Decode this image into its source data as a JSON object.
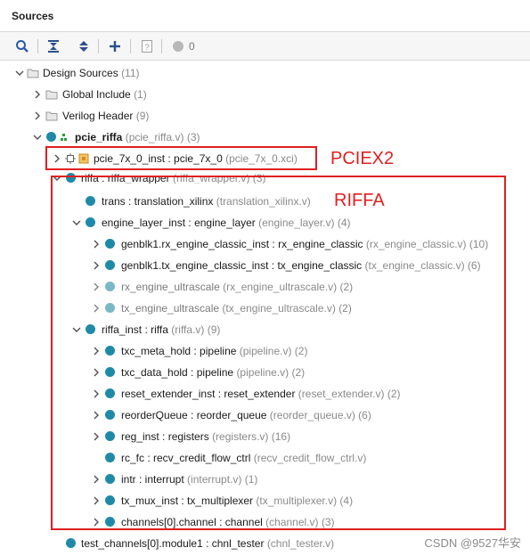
{
  "panel": {
    "title": "Sources"
  },
  "toolbar": {
    "warning_count": "0"
  },
  "tree": {
    "design_sources": {
      "label": "Design Sources",
      "count": "(11)"
    },
    "global_include": {
      "label": "Global Include",
      "count": "(1)"
    },
    "verilog_header": {
      "label": "Verilog Header",
      "count": "(9)"
    },
    "top": {
      "label": "pcie_riffa",
      "file": "(pcie_riffa.v) (3)"
    },
    "pcie_ip": {
      "label": "pcie_7x_0_inst : pcie_7x_0",
      "file": "(pcie_7x_0.xci)"
    },
    "riffa_wrapper": {
      "label": "riffa : riffa_wrapper",
      "file": "(riffa_wrapper.v) (3)"
    },
    "trans": {
      "label": "trans : translation_xilinx",
      "file": "(translation_xilinx.v)"
    },
    "engine_layer": {
      "label": "engine_layer_inst : engine_layer",
      "file": "(engine_layer.v) (4)"
    },
    "rx_classic": {
      "label": "genblk1.rx_engine_classic_inst : rx_engine_classic",
      "file": "(rx_engine_classic.v) (10)"
    },
    "tx_classic": {
      "label": "genblk1.tx_engine_classic_inst : tx_engine_classic",
      "file": "(tx_engine_classic.v) (6)"
    },
    "rx_ultra": {
      "label": "rx_engine_ultrascale",
      "file": "(rx_engine_ultrascale.v) (2)"
    },
    "tx_ultra": {
      "label": "tx_engine_ultrascale",
      "file": "(tx_engine_ultrascale.v) (2)"
    },
    "riffa_inst": {
      "label": "riffa_inst : riffa",
      "file": "(riffa.v) (9)"
    },
    "txc_meta": {
      "label": "txc_meta_hold : pipeline",
      "file": "(pipeline.v) (2)"
    },
    "txc_data": {
      "label": "txc_data_hold : pipeline",
      "file": "(pipeline.v) (2)"
    },
    "reset_ext": {
      "label": "reset_extender_inst : reset_extender",
      "file": "(reset_extender.v) (2)"
    },
    "reorder": {
      "label": "reorderQueue : reorder_queue",
      "file": "(reorder_queue.v) (6)"
    },
    "reg_inst": {
      "label": "reg_inst : registers",
      "file": "(registers.v) (16)"
    },
    "rc_fc": {
      "label": "rc_fc : recv_credit_flow_ctrl",
      "file": "(recv_credit_flow_ctrl.v)"
    },
    "intr": {
      "label": "intr : interrupt",
      "file": "(interrupt.v) (1)"
    },
    "tx_mux": {
      "label": "tx_mux_inst : tx_multiplexer",
      "file": "(tx_multiplexer.v) (4)"
    },
    "channels": {
      "label": "channels[0].channel : channel",
      "file": "(channel.v) (3)"
    },
    "test_channels": {
      "label": "test_channels[0].module1 : chnl_tester",
      "file": "(chnl_tester.v)"
    }
  },
  "annotations": {
    "pciex2": "PCIEX2",
    "riffa": "RIFFA"
  },
  "watermark": "CSDN @9527华安",
  "colors": {
    "highlight": "#e02020",
    "module_dot": "#1f8aa8",
    "gray_text": "#8a8a8a"
  }
}
